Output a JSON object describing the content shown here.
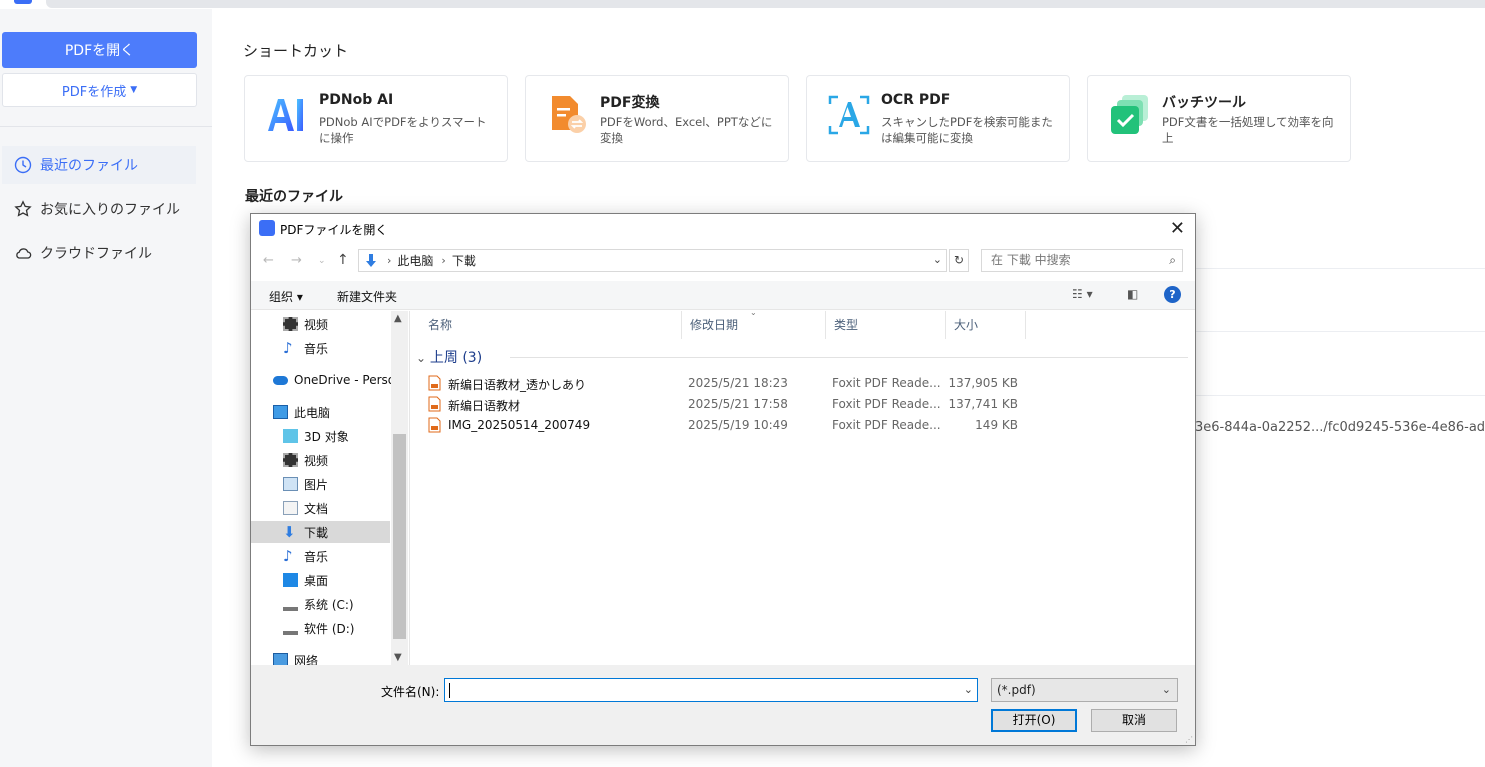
{
  "sidebar": {
    "open_pdf": "PDFを開く",
    "create_pdf": "PDFを作成",
    "items": [
      {
        "label": "最近のファイル"
      },
      {
        "label": "お気に入りのファイル"
      },
      {
        "label": "クラウドファイル"
      }
    ]
  },
  "main": {
    "shortcut_title": "ショートカット",
    "cards": [
      {
        "title": "PDNob AI",
        "desc": "PDNob AIでPDFをよりスマートに操作"
      },
      {
        "title": "PDF変換",
        "desc": "PDFをWord、Excel、PPTなどに変換"
      },
      {
        "title": "OCR PDF",
        "desc": "スキャンしたPDFを検索可能または編集可能に変換"
      },
      {
        "title": "バッチツール",
        "desc": "PDF文書を一括処理して効率を向上"
      }
    ],
    "recent_title": "最近のファイル",
    "path_text": "3e6-844a-0a2252.../fc0d9245-536e-4e86-ad8"
  },
  "dialog": {
    "title": "PDFファイルを開く",
    "path": [
      "此电脑",
      "下載"
    ],
    "search_placeholder": "在 下載 中搜索",
    "toolbar": {
      "organize": "组织",
      "new_folder": "新建文件夹",
      "help": "?"
    },
    "tree": [
      {
        "label": "视频"
      },
      {
        "label": "音乐"
      },
      {
        "label": "OneDrive - Perso"
      },
      {
        "label": "此电脑"
      },
      {
        "label": "3D 对象"
      },
      {
        "label": "视频"
      },
      {
        "label": "图片"
      },
      {
        "label": "文档"
      },
      {
        "label": "下載"
      },
      {
        "label": "音乐"
      },
      {
        "label": "桌面"
      },
      {
        "label": "系统 (C:)"
      },
      {
        "label": "软件 (D:)"
      },
      {
        "label": "网络"
      }
    ],
    "columns": {
      "name": "名称",
      "date": "修改日期",
      "type": "类型",
      "size": "大小"
    },
    "group": "上周 (3)",
    "files": [
      {
        "name": "新编日语教材_透かしあり",
        "date": "2025/5/21 18:23",
        "type": "Foxit PDF Reade...",
        "size": "137,905 KB"
      },
      {
        "name": "新编日语教材",
        "date": "2025/5/21 17:58",
        "type": "Foxit PDF Reade...",
        "size": "137,741 KB"
      },
      {
        "name": "IMG_20250514_200749",
        "date": "2025/5/19 10:49",
        "type": "Foxit PDF Reade...",
        "size": "149 KB"
      }
    ],
    "filename_label": "文件名(N):",
    "filename_value": "",
    "filter": "(*.pdf)",
    "open_button": "打开(O)",
    "cancel_button": "取消"
  }
}
